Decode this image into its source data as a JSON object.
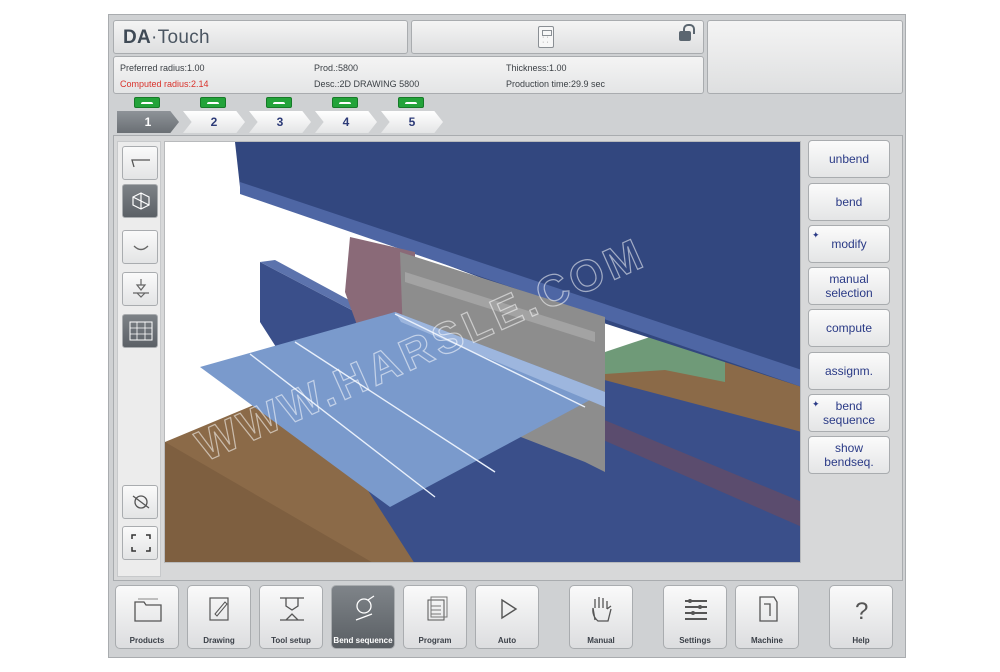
{
  "header": {
    "logo_brand": "DA",
    "logo_product": "·Touch"
  },
  "icons": {
    "calculator": "calculator-icon",
    "lock": "unlocked-padlock-icon"
  },
  "info": {
    "preferred_radius": "Preferred radius:1.00",
    "computed_radius": "Computed radius:2.14",
    "prod": "Prod.:5800",
    "desc": "Desc.:2D DRAWING 5800",
    "thickness": "Thickness:1.00",
    "production_time": "Production time:29.9 sec"
  },
  "colors": {
    "computed_radius": "#d9322b",
    "accent_text": "#2a3a86",
    "status_green": "#23a33a",
    "beam_blue": "#33477f",
    "sheet_blue": "#7a9acc",
    "table_brown": "#8b6a48"
  },
  "bend_tabs": [
    {
      "label": "1",
      "active": true
    },
    {
      "label": "2",
      "active": false
    },
    {
      "label": "3",
      "active": false
    },
    {
      "label": "4",
      "active": false
    },
    {
      "label": "5",
      "active": false
    }
  ],
  "side_buttons": [
    {
      "label": "unbend",
      "star": false
    },
    {
      "label": "bend",
      "star": false
    },
    {
      "label": "modify",
      "star": true
    },
    {
      "label": "manual selection",
      "star": false
    },
    {
      "label": "compute",
      "star": false
    },
    {
      "label": "assignm.",
      "star": false
    },
    {
      "label": "bend sequence",
      "star": true
    },
    {
      "label": "show bendseq.",
      "star": false
    }
  ],
  "watermark": "WWW.HARSLE.COM",
  "bottom_nav": [
    {
      "label": "Products",
      "icon": "folder-icon"
    },
    {
      "label": "Drawing",
      "icon": "pencil-icon"
    },
    {
      "label": "Tool setup",
      "icon": "press-tool-icon"
    },
    {
      "label": "Bend sequence",
      "icon": "robot-bend-icon",
      "active": true
    },
    {
      "label": "Program",
      "icon": "document-stack-icon"
    },
    {
      "label": "Auto",
      "icon": "play-icon"
    },
    {
      "label": "Manual",
      "icon": "hand-icon"
    },
    {
      "label": "Settings",
      "icon": "settings-list-icon"
    },
    {
      "label": "Machine",
      "icon": "machine-icon"
    },
    {
      "label": "Help",
      "icon": "question-icon"
    }
  ]
}
